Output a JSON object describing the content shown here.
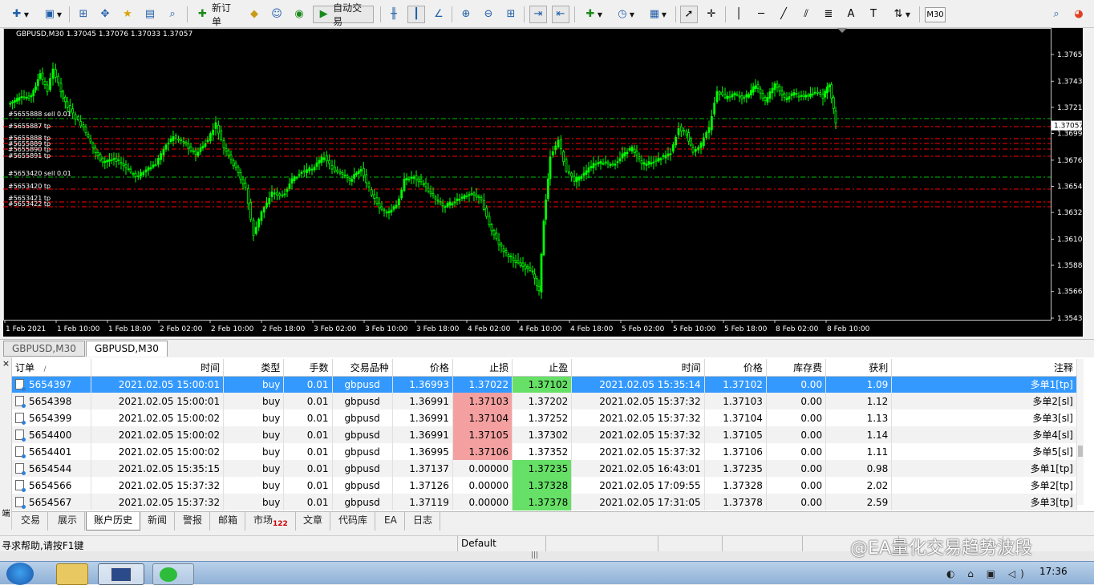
{
  "toolbar": {
    "new_order": "新订单",
    "auto_trading": "自动交易",
    "timeframe": "M30"
  },
  "chart": {
    "info": "GBPUSD,M30  1.37045 1.37076 1.37033 1.37057",
    "current_price": "1.37057",
    "price_labels": [
      "1.37655",
      "1.37430",
      "1.37210",
      "1.36990",
      "1.36765",
      "1.36545",
      "1.36325",
      "1.36100",
      "1.35880",
      "1.35660",
      "1.35435"
    ],
    "time_labels": [
      "1 Feb 2021",
      "1 Feb 10:00",
      "1 Feb 18:00",
      "2 Feb 02:00",
      "2 Feb 10:00",
      "2 Feb 18:00",
      "3 Feb 02:00",
      "3 Feb 10:00",
      "3 Feb 18:00",
      "4 Feb 02:00",
      "4 Feb 10:00",
      "4 Feb 18:00",
      "5 Feb 02:00",
      "5 Feb 10:00",
      "5 Feb 18:00",
      "8 Feb 02:00",
      "8 Feb 10:00"
    ],
    "order_labels": [
      "#5655888 sell 0.01",
      "#5655887 tp",
      "#5655888 tp",
      "#5655889 tp",
      "#5655890 tp",
      "#5655891 tp",
      "#5653420 sell 0.01",
      "#5653420 tp",
      "#5653421 tp",
      "#5653422 tp"
    ]
  },
  "chart_tabs": [
    "GBPUSD,M30",
    "GBPUSD,M30"
  ],
  "history": {
    "columns": [
      "订单",
      "时间",
      "类型",
      "手数",
      "交易品种",
      "价格",
      "止损",
      "止盈",
      "时间",
      "价格",
      "库存费",
      "获利",
      "注释"
    ],
    "sort_mark": "/",
    "rows": [
      [
        "5654397",
        "2021.02.05 15:00:01",
        "buy",
        "0.01",
        "gbpusd",
        "1.36993",
        "1.37022",
        "1.37102",
        "2021.02.05 15:35:14",
        "1.37102",
        "0.00",
        "1.09",
        "多单1[tp]"
      ],
      [
        "5654398",
        "2021.02.05 15:00:01",
        "buy",
        "0.01",
        "gbpusd",
        "1.36991",
        "1.37103",
        "1.37202",
        "2021.02.05 15:37:32",
        "1.37103",
        "0.00",
        "1.12",
        "多单2[sl]"
      ],
      [
        "5654399",
        "2021.02.05 15:00:02",
        "buy",
        "0.01",
        "gbpusd",
        "1.36991",
        "1.37104",
        "1.37252",
        "2021.02.05 15:37:32",
        "1.37104",
        "0.00",
        "1.13",
        "多单3[sl]"
      ],
      [
        "5654400",
        "2021.02.05 15:00:02",
        "buy",
        "0.01",
        "gbpusd",
        "1.36991",
        "1.37105",
        "1.37302",
        "2021.02.05 15:37:32",
        "1.37105",
        "0.00",
        "1.14",
        "多单4[sl]"
      ],
      [
        "5654401",
        "2021.02.05 15:00:02",
        "buy",
        "0.01",
        "gbpusd",
        "1.36995",
        "1.37106",
        "1.37352",
        "2021.02.05 15:37:32",
        "1.37106",
        "0.00",
        "1.11",
        "多单5[sl]"
      ],
      [
        "5654544",
        "2021.02.05 15:35:15",
        "buy",
        "0.01",
        "gbpusd",
        "1.37137",
        "0.00000",
        "1.37235",
        "2021.02.05 16:43:01",
        "1.37235",
        "0.00",
        "0.98",
        "多单1[tp]"
      ],
      [
        "5654566",
        "2021.02.05 15:37:32",
        "buy",
        "0.01",
        "gbpusd",
        "1.37126",
        "0.00000",
        "1.37328",
        "2021.02.05 17:09:55",
        "1.37328",
        "0.00",
        "2.02",
        "多单2[tp]"
      ],
      [
        "5654567",
        "2021.02.05 15:37:32",
        "buy",
        "0.01",
        "gbpusd",
        "1.37119",
        "0.00000",
        "1.37378",
        "2021.02.05 17:31:05",
        "1.37378",
        "0.00",
        "2.59",
        "多单3[tp]"
      ]
    ]
  },
  "terminal_vertical_label": "端",
  "bottom_tabs": [
    "交易",
    "展示",
    "账户历史",
    "新闻",
    "警报",
    "邮箱",
    "市场",
    "文章",
    "代码库",
    "EA",
    "日志"
  ],
  "market_badge": "122",
  "status": {
    "help": "寻求帮助,请按F1键",
    "profile": "Default"
  },
  "taskbar": {
    "time": "17:36"
  },
  "watermark": "@EA量化交易趋势波段",
  "colors": {
    "candle": "#00ff00",
    "tp_line": "#ff0000",
    "entry_line": "#00c000",
    "selection": "#3399ff"
  }
}
